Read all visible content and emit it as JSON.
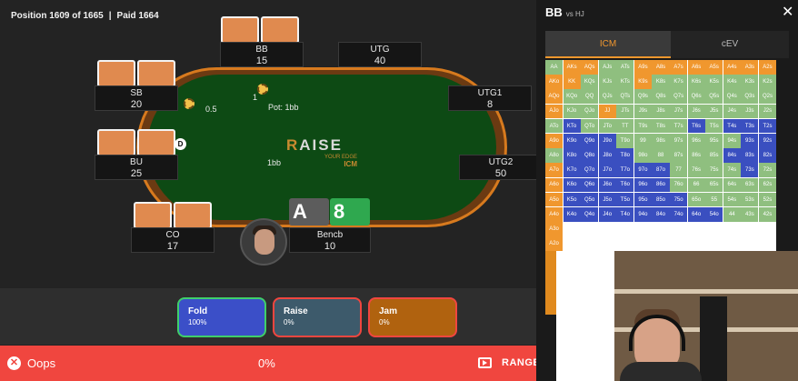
{
  "header": {
    "position": "Position 1609 of 1665",
    "paid": "Paid 1664"
  },
  "seats": {
    "bb": {
      "name": "BB",
      "stack": "15"
    },
    "utg": {
      "name": "UTG",
      "stack": "40"
    },
    "sb": {
      "name": "SB",
      "stack": "20"
    },
    "utg1": {
      "name": "UTG1",
      "stack": "8"
    },
    "bu": {
      "name": "BU",
      "stack": "25"
    },
    "utg2": {
      "name": "UTG2",
      "stack": "50"
    },
    "co": {
      "name": "CO",
      "stack": "17"
    },
    "hero": {
      "name": "Bencb",
      "stack": "10"
    }
  },
  "table": {
    "pot": "Pot: 1bb",
    "sb_bet": "0.5",
    "bb_bet": "1bb",
    "bb_chip_label": "1",
    "dealer_button": "D",
    "logo_main_r": "R",
    "logo_main_rest": "AISE",
    "logo_small": "YOUR EDGE",
    "logo_icm": "ICM"
  },
  "hole_cards": [
    {
      "rank": "A",
      "color": "#5c5c5c"
    },
    {
      "rank": "8",
      "color": "#2fa84f"
    }
  ],
  "actions": [
    {
      "label": "Fold",
      "pct": "100%",
      "bg": "#3b4fc8",
      "border": "#3fcf6a"
    },
    {
      "label": "Raise",
      "pct": "0%",
      "bg": "#3d5a6b",
      "border": "#f0463f"
    },
    {
      "label": "Jam",
      "pct": "0%",
      "bg": "#b0620f",
      "border": "#f0463f"
    }
  ],
  "feedback": {
    "icon": "✕",
    "text": "Oops",
    "percent": "0%",
    "range_label": "RANGE"
  },
  "panel": {
    "title": "BB",
    "subtitle": "vs HJ",
    "close": "✕",
    "tabs": {
      "icm": "ICM",
      "cev": "cEV"
    }
  },
  "colors": {
    "green": "#8fbf7f",
    "orange": "#f0972e",
    "blue": "#3a4fc0"
  },
  "range_grid": [
    [
      "AA:g",
      "AKs:o",
      "AQs:o",
      "AJs:g",
      "ATs:g",
      "A9s:o",
      "A8s:o",
      "A7s:o",
      "A6s:o",
      "A5s:o",
      "A4s:o",
      "A3s:o",
      "A2s:o"
    ],
    [
      "AKo:o",
      "KK:o",
      "KQs:g",
      "KJs:g",
      "KTs:g",
      "K9s:o",
      "K8s:g",
      "K7s:g",
      "K6s:g",
      "K5s:g",
      "K4s:g",
      "K3s:g",
      "K2s:g"
    ],
    [
      "AQo:o",
      "KQo:g",
      "QQ:g",
      "QJs:g",
      "QTs:g",
      "Q9s:g",
      "Q8s:g",
      "Q7s:g",
      "Q6s:g",
      "Q5s:g",
      "Q4s:g",
      "Q3s:g",
      "Q2s:g"
    ],
    [
      "AJo:o",
      "KJo:g",
      "QJo:g",
      "JJ:o",
      "JTs:g",
      "J9s:g",
      "J8s:g",
      "J7s:g",
      "J6s:g",
      "J5s:g",
      "J4s:g",
      "J3s:g",
      "J2s:g"
    ],
    [
      "ATo:g",
      "KTo:b",
      "QTo:g",
      "JTo:g",
      "TT:g",
      "T9s:g",
      "T8s:g",
      "T7s:g",
      "T6s:b",
      "T5s:g",
      "T4s:b",
      "T3s:b",
      "T2s:b"
    ],
    [
      "A9o:o",
      "K9o:b",
      "Q9o:b",
      "J9o:b",
      "T9o:g",
      "99:g",
      "98s:g",
      "97s:g",
      "96s:g",
      "95s:g",
      "94s:g",
      "93s:b",
      "92s:b"
    ],
    [
      "A8o:g",
      "K8o:b",
      "Q8o:b",
      "J8o:b",
      "T8o:b",
      "98o:g",
      "88:g",
      "87s:g",
      "86s:g",
      "85s:g",
      "84s:b",
      "83s:b",
      "82s:b"
    ],
    [
      "A7o:o",
      "K7o:b",
      "Q7o:b",
      "J7o:b",
      "T7o:b",
      "97o:b",
      "87o:b",
      "77:g",
      "76s:g",
      "75s:g",
      "74s:g",
      "73s:b",
      "72s:g"
    ],
    [
      "A6o:o",
      "K6o:b",
      "Q6o:b",
      "J6o:b",
      "T6o:b",
      "96o:b",
      "86o:b",
      "76o:g",
      "66:g",
      "65s:g",
      "64s:g",
      "63s:g",
      "62s:g"
    ],
    [
      "A5o:o",
      "K5o:b",
      "Q5o:b",
      "J5o:b",
      "T5o:b",
      "95o:b",
      "85o:b",
      "75o:b",
      "65o:g",
      "55:g",
      "54s:g",
      "53s:g",
      "52s:g"
    ],
    [
      "A4o:o",
      "K4o:b",
      "Q4o:b",
      "J4o:b",
      "T4o:b",
      "94o:b",
      "84o:b",
      "74o:b",
      "64o:b",
      "54o:b",
      "44:g",
      "43s:g",
      "42s:g"
    ],
    [
      "A3o:o",
      "",
      "",
      "",
      "",
      "",
      "",
      "",
      "",
      "",
      "",
      "",
      ""
    ],
    [
      "A2o:o",
      "",
      "",
      "",
      "",
      "",
      "",
      "",
      "",
      "",
      "",
      "",
      ""
    ]
  ]
}
